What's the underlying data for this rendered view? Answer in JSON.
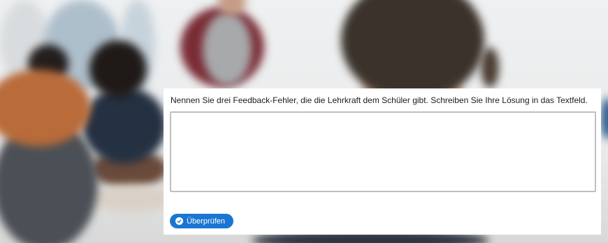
{
  "task": {
    "question": "Nennen Sie drei Feedback-Fehler, die die Lehrkraft dem Schüler gibt. Schreiben Sie Ihre Lösung in das Textfeld.",
    "answer_value": "",
    "check_button_label": "Überprüfen",
    "check_icon": "check-circle-icon"
  },
  "colors": {
    "accent": "#1a76d2",
    "panel_background": "#ffffff",
    "textarea_border": "#bfbfbf"
  }
}
